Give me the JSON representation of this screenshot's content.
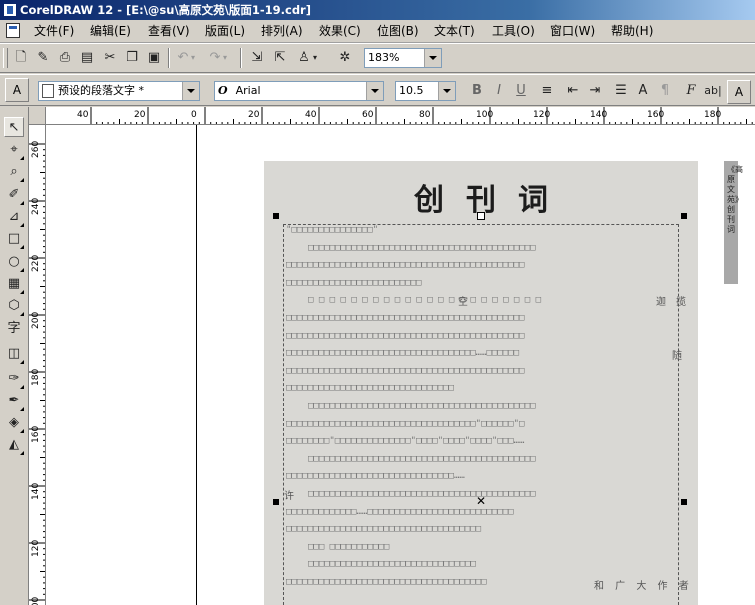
{
  "window": {
    "title": "CorelDRAW 12 - [E:\\@su\\高原文苑\\版面1-19.cdr]"
  },
  "menu": [
    "文件(F)",
    "编辑(E)",
    "查看(V)",
    "版面(L)",
    "排列(A)",
    "效果(C)",
    "位图(B)",
    "文本(T)",
    "工具(O)",
    "窗口(W)",
    "帮助(H)"
  ],
  "standard_toolbar": {
    "zoom": "183%"
  },
  "property_bar": {
    "paragraph_style": "预设的段落文字 *",
    "font_name": "Arial",
    "font_size": "10.5"
  },
  "hruler": {
    "labels": [
      "40",
      "20",
      "0",
      "20",
      "40",
      "60",
      "80",
      "100",
      "120",
      "140",
      "160",
      "180"
    ]
  },
  "vruler": {
    "labels": [
      "260",
      "240",
      "220",
      "200",
      "180",
      "160",
      "140",
      "120",
      "100"
    ]
  },
  "document": {
    "heading": "创刊词",
    "side_tab": "《高原文苑》创刊词",
    "margin_chars": {
      "kong": "空",
      "jia": "迦",
      "lan": "揽",
      "sui": "随",
      "ya": "许",
      "tail": "和 广 大 作 者"
    },
    "lines": [
      "\"□□□□□□□□□□□□□□□\"",
      "□□□□□□□□□□□□□□□□□□□□□□□□□□□□□□□□□□□□□□□□□□",
      "□□□□□□□□□□□□□□□□□□□□□□□□□□□□□□□□□□□□□□□□□□□□",
      "□□□□□□□□□□□□□□□□□□□□□□□□□",
      "□ □ □ □ □ □ □ □ □ □ □ □ □ □ □ □ □ □ □ □ □ □",
      "□□□□□□□□□□□□□□□□□□□□□□□□□□□□□□□□□□□□□□□□□□□□",
      "□□□□□□□□□□□□□□□□□□□□□□□□□□□□□□□□□□□□□□□□□□□□",
      "□□□□□□□□□□□□□□□□□□□□□□□□□□□□□□□□□□□……□□□□□□",
      "□□□□□□□□□□□□□□□□□□□□□□□□□□□□□□□□□□□□□□□□□□□□",
      "□□□□□□□□□□□□□□□□□□□□□□□□□□□□□□□",
      "□□□□□□□□□□□□□□□□□□□□□□□□□□□□□□□□□□□□□□□□□□",
      "□□□□□□□□□□□□□□□□□□□□□□□□□□□□□□□□□□□\"□□□□□□\"□",
      "□□□□□□□□\"□□□□□□□□□□□□□□\"□□□□\"□□□□\"□□□□\"□□□……",
      "□□□□□□□□□□□□□□□□□□□□□□□□□□□□□□□□□□□□□□□□□□",
      "□□□□□□□□□□□□□□□□□□□□□□□□□□□□□□□……",
      "□□□□□□□□□□□□□□□□□□□□□□□□□□□□□□□□□□□□□□□□□□",
      "□□□□□□□□□□□□□……□□□□□□□□□□□□□□□□□□□□□□□□□□□",
      "□□□□□□□□□□□□□□□□□□□□□□□□□□□□□□□□□□□□",
      "□□□ □□□□□□□□□□□",
      "□□□□□□□□□□□□□□□□□□□□□□□□□□□□□□□",
      "□□□□□□□□□□□□□□□□□□□□□□□□□□□□□□□□□□□□□"
    ]
  },
  "icons": {
    "toolbox": [
      "pick-tool-icon",
      "shape-tool-icon",
      "zoom-tool-icon",
      "freehand-tool-icon",
      "smart-fill-icon",
      "rectangle-tool-icon",
      "ellipse-tool-icon",
      "graph-paper-icon",
      "basic-shapes-icon",
      "text-tool-icon",
      "interactive-blend-icon",
      "eyedropper-icon",
      "outline-tool-icon",
      "fill-tool-icon",
      "interactive-fill-icon"
    ]
  }
}
